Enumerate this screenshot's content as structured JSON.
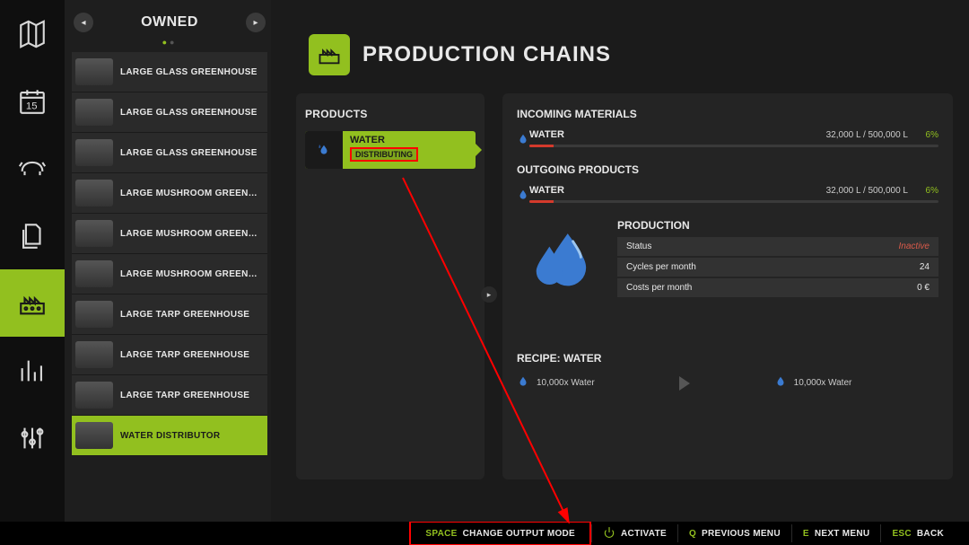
{
  "rail": {
    "items": [
      {
        "name": "map-icon"
      },
      {
        "name": "calendar-icon"
      },
      {
        "name": "animals-icon"
      },
      {
        "name": "documents-icon"
      },
      {
        "name": "production-icon",
        "active": true
      },
      {
        "name": "stats-icon"
      },
      {
        "name": "settings-icon"
      }
    ]
  },
  "owned": {
    "title": "OWNED",
    "items": [
      "LARGE GLASS GREENHOUSE",
      "LARGE GLASS GREENHOUSE",
      "LARGE GLASS GREENHOUSE",
      "LARGE MUSHROOM GREEN…",
      "LARGE MUSHROOM GREEN…",
      "LARGE MUSHROOM GREEN…",
      "LARGE TARP GREENHOUSE",
      "LARGE TARP GREENHOUSE",
      "LARGE TARP GREENHOUSE",
      "WATER DISTRIBUTOR"
    ],
    "selected_index": 9
  },
  "header": {
    "title": "PRODUCTION CHAINS"
  },
  "products": {
    "title": "PRODUCTS",
    "item": {
      "name": "WATER",
      "status": "DISTRIBUTING"
    }
  },
  "incoming": {
    "title": "INCOMING MATERIALS",
    "rows": [
      {
        "name": "WATER",
        "value": "32,000 L / 500,000 L",
        "pct": "6%"
      }
    ]
  },
  "outgoing": {
    "title": "OUTGOING PRODUCTS",
    "rows": [
      {
        "name": "WATER",
        "value": "32,000 L / 500,000 L",
        "pct": "6%"
      }
    ]
  },
  "production": {
    "title": "PRODUCTION",
    "rows": [
      {
        "label": "Status",
        "value": "Inactive",
        "inactive": true
      },
      {
        "label": "Cycles per month",
        "value": "24"
      },
      {
        "label": "Costs per month",
        "value": "0 €"
      }
    ]
  },
  "recipe": {
    "title": "RECIPE: WATER",
    "input": "10,000x Water",
    "output": "10,000x Water"
  },
  "footer": {
    "change_key": "SPACE",
    "change_label": "CHANGE OUTPUT MODE",
    "activate_label": "ACTIVATE",
    "prev_key": "Q",
    "prev_label": "PREVIOUS MENU",
    "next_key": "E",
    "next_label": "NEXT MENU",
    "back_key": "ESC",
    "back_label": "BACK"
  }
}
